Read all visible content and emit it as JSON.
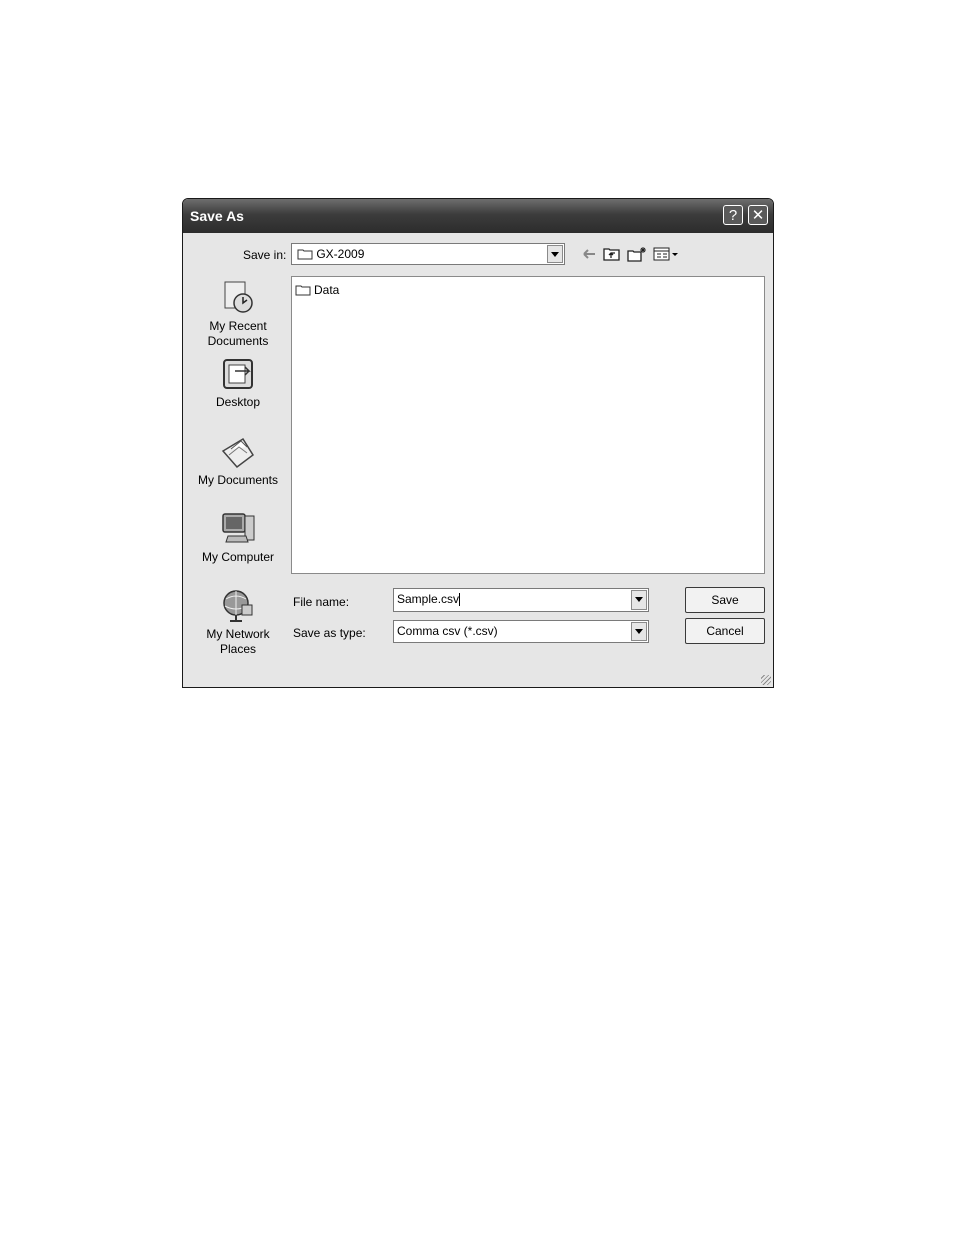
{
  "dialog": {
    "title": "Save As",
    "help_glyph": "?",
    "close_glyph": "✕"
  },
  "save_in": {
    "label": "Save in:",
    "value": "GX-2009"
  },
  "toolbar": {
    "icons": [
      "back-arrow-icon",
      "up-folder-icon",
      "new-folder-icon",
      "view-menu-icon"
    ]
  },
  "files": [
    {
      "name": "Data",
      "icon": "folder-icon"
    }
  ],
  "places": [
    {
      "label": "My Recent Documents",
      "icon": "recent-documents-icon"
    },
    {
      "label": "Desktop",
      "icon": "desktop-icon"
    },
    {
      "label": "My Documents",
      "icon": "my-documents-icon"
    },
    {
      "label": "My Computer",
      "icon": "my-computer-icon"
    },
    {
      "label": "My Network Places",
      "icon": "network-places-icon"
    }
  ],
  "file_name": {
    "label": "File name:",
    "value": "Sample.csv"
  },
  "save_as_type": {
    "label": "Save as type:",
    "value": "Comma csv (*.csv)"
  },
  "buttons": {
    "save": "Save",
    "cancel": "Cancel"
  }
}
